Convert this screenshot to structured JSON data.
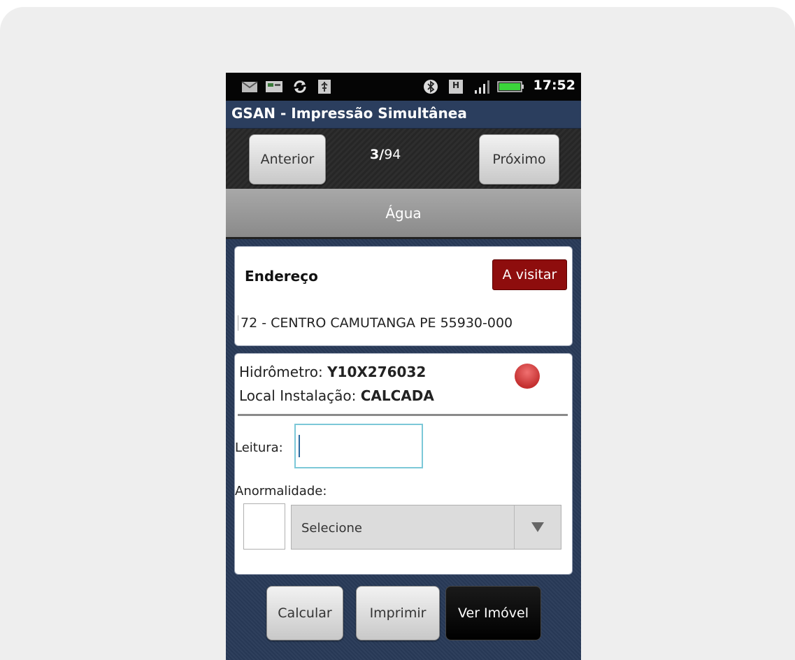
{
  "status_bar": {
    "time": "17:52",
    "icons": [
      "mail-icon",
      "screenshot-icon",
      "sync-icon",
      "usb-icon",
      "bluetooth-icon",
      "h-data-icon",
      "signal-icon",
      "battery-icon"
    ]
  },
  "app": {
    "title": "GSAN - Impressão Simultânea"
  },
  "nav": {
    "prev_label": "Anterior",
    "next_label": "Próximo",
    "current": "3",
    "separator": "/",
    "total": "94"
  },
  "section": {
    "title": "Água"
  },
  "address": {
    "title": "Endereço",
    "status_badge": "A visitar",
    "text": "72 - CENTRO CAMUTANGA PE 55930-000"
  },
  "meter": {
    "meter_label": "Hidrômetro: ",
    "meter_value": "Y10X276032",
    "location_label": "Local Instalação: ",
    "location_value": "CALCADA",
    "reading_label": "Leitura:",
    "reading_value": "",
    "anomaly_label": "Anormalidade:",
    "anomaly_selected": "Selecione",
    "status_color": "#c43030"
  },
  "actions": {
    "calculate": "Calcular",
    "print": "Imprimir",
    "view_property": "Ver Imóvel"
  }
}
